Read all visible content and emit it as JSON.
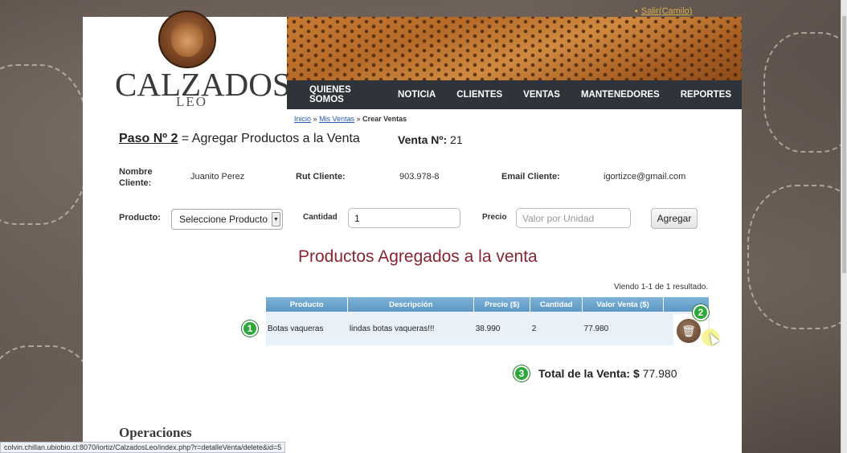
{
  "header": {
    "logout_label": "Salir(Camilo)",
    "logo_title": "CALZADOS",
    "logo_subtitle": "LEO"
  },
  "nav": {
    "items": [
      "QUIENES SOMOS",
      "NOTICIA",
      "CLIENTES",
      "VENTAS",
      "MANTENEDORES",
      "REPORTES"
    ]
  },
  "breadcrumb": {
    "home": "Inicio",
    "sep1": "»",
    "my_sales": "Mis Ventas",
    "sep2": "»",
    "current": "Crear Ventas"
  },
  "step": {
    "label": "Paso Nº 2",
    "text": "= Agregar Productos a la Venta",
    "sale_label": "Venta Nº:",
    "sale_number": "21"
  },
  "client": {
    "name_label": "Nombre Cliente:",
    "name_value": "Juanito Perez",
    "rut_label": "Rut Cliente:",
    "rut_value": "903.978-8",
    "email_label": "Email Cliente:",
    "email_value": "igortizce@gmail.com"
  },
  "form": {
    "product_label": "Producto:",
    "product_selected": "Seleccione Producto",
    "quantity_label": "Cantidad",
    "quantity_value": "1",
    "price_label": "Precio",
    "price_placeholder": "Valor por Unidad",
    "add_button": "Agregar"
  },
  "products_section": {
    "title": "Productos Agregados a la venta",
    "summary": "Viendo 1-1 de 1 resultado.",
    "columns": [
      "Producto",
      "Descripción",
      "Precio ($)",
      "Cantidad",
      "Valor Venta ($)",
      ""
    ],
    "rows": [
      {
        "producto": "Botas vaqueras",
        "descripcion": "lindas botas vaqueras!!!",
        "precio": "38.990",
        "cantidad": "2",
        "valor": "77.980"
      }
    ]
  },
  "total": {
    "label": "Total de la Venta: $",
    "value": "77.980"
  },
  "operations_title": "Operaciones",
  "status_url": "colvin.chillan.ubiobio.cl:8070/iortiz/CalzadosLeo/index.php?r=detalleVenta/delete&id=5",
  "badges": [
    "1",
    "2",
    "3"
  ],
  "icons": {
    "delete": "trash-icon",
    "logout_bullet": "bullet-icon",
    "select_arrow": "chevron-down-icon"
  },
  "colors": {
    "nav_bg": "#2f343a",
    "section_title": "#8b2330",
    "table_header": "#6aa3cc",
    "badge": "#2fa83a"
  }
}
